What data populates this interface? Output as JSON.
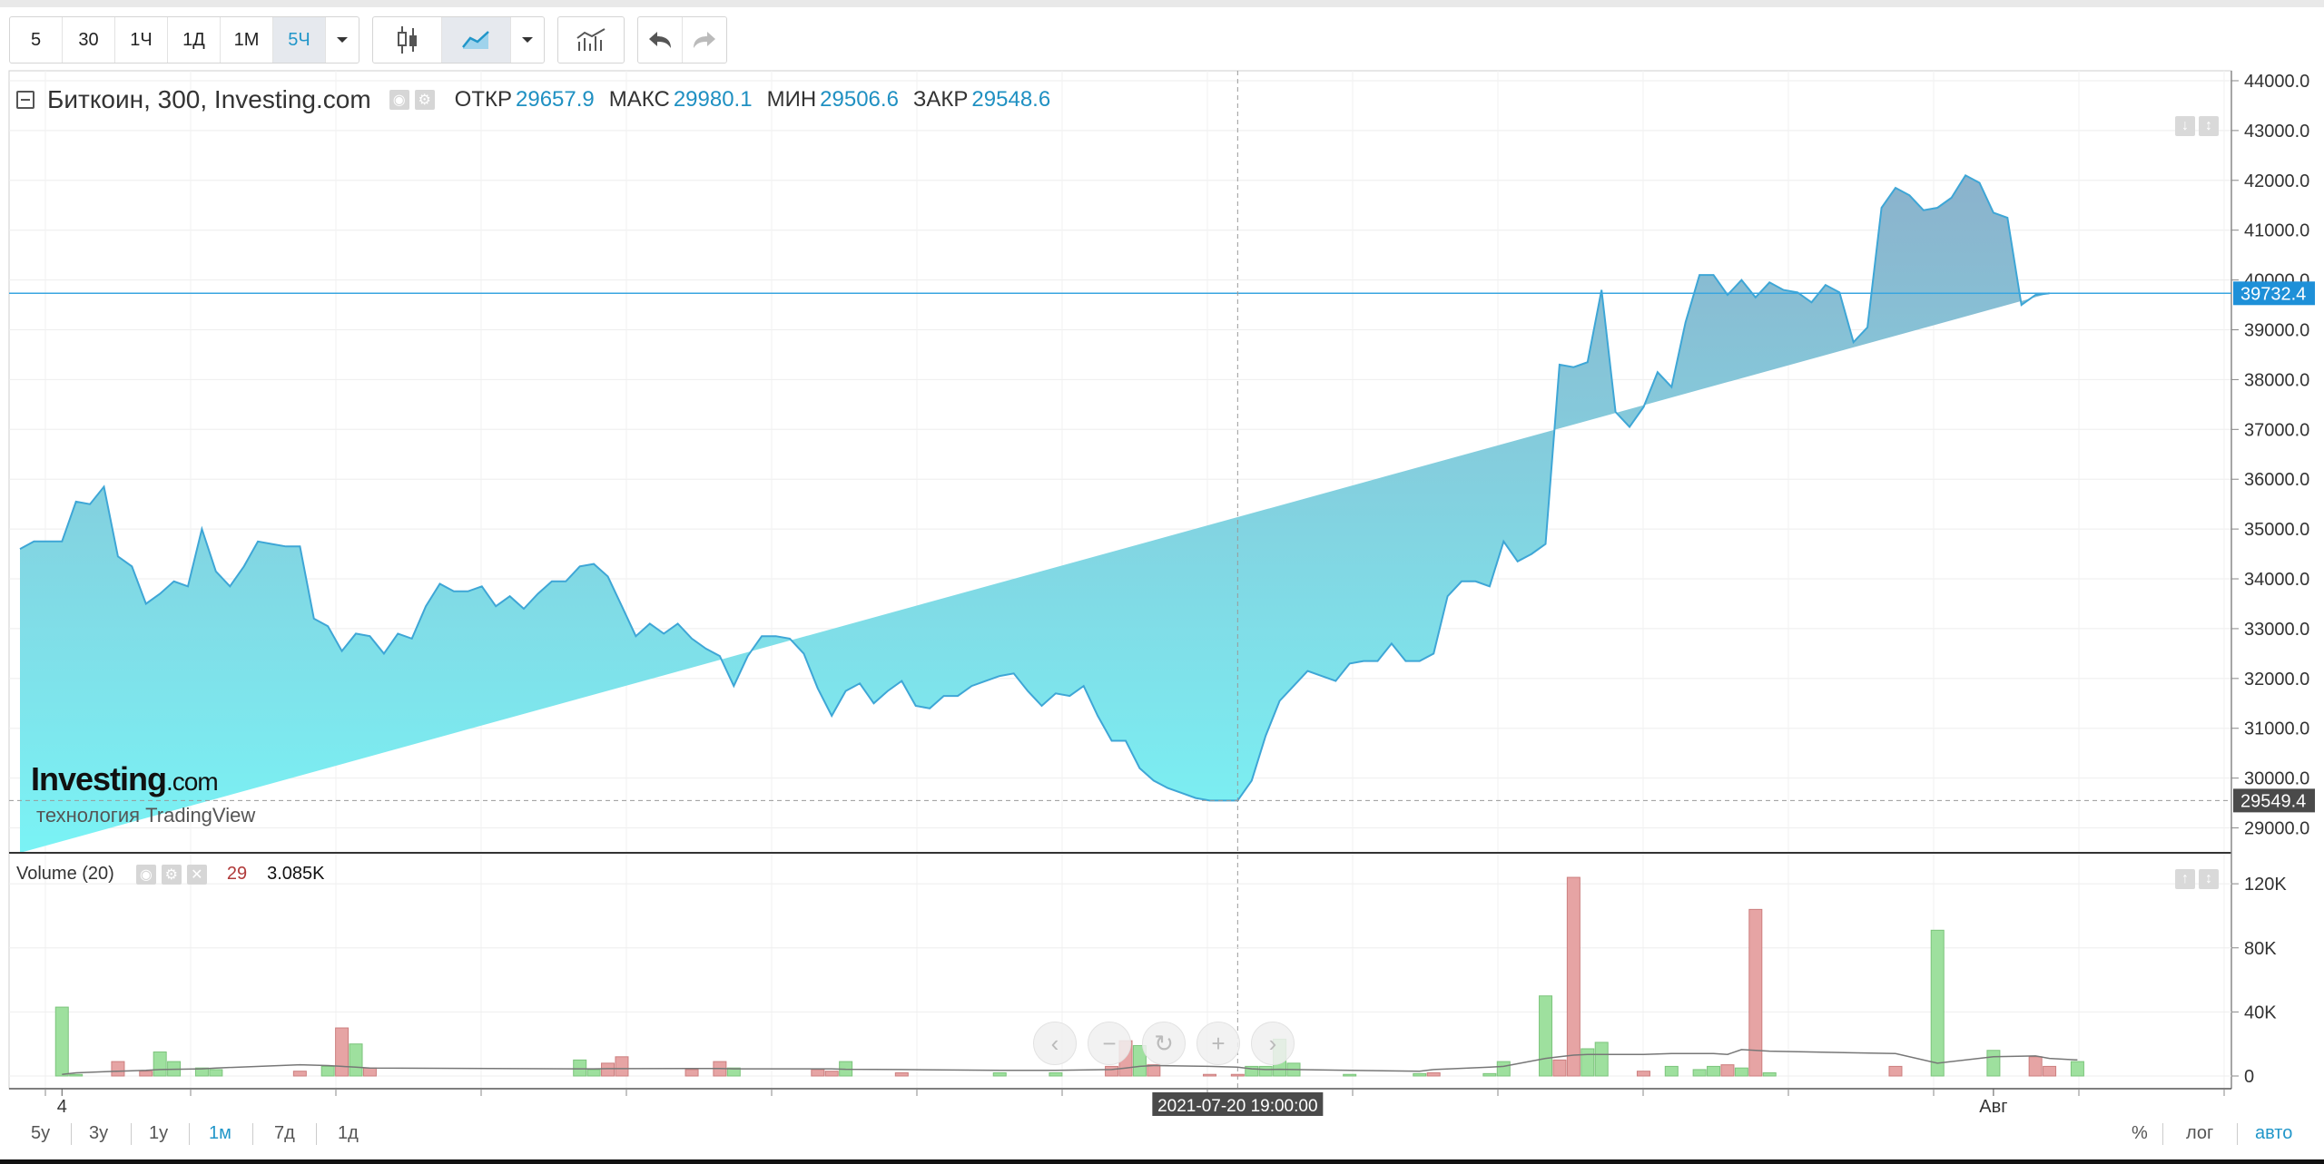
{
  "toolbar": {
    "intervals": [
      "5",
      "30",
      "1Ч",
      "1Д",
      "1М",
      "5Ч"
    ],
    "active_interval": "5Ч"
  },
  "legend": {
    "title": "Биткоин, 300, Investing.com",
    "open_label": "ОТКР",
    "open_value": "29657.9",
    "high_label": "МАКС",
    "high_value": "29980.1",
    "low_label": "МИН",
    "low_value": "29506.6",
    "close_label": "ЗАКР",
    "close_value": "29548.6"
  },
  "volume_legend": {
    "name": "Volume (20)",
    "length": "29",
    "value": "3.085K"
  },
  "watermark": {
    "brand": "Investing",
    "brand_suffix": ".com",
    "tagline": "технология TradingView"
  },
  "crosshair": {
    "time_label": "2021-07-20 19:00:00",
    "price_label": "29549.4"
  },
  "last_price_label": "39732.4",
  "bottom_bar": {
    "ranges": [
      "5y",
      "3y",
      "1y",
      "1м",
      "7д",
      "1д"
    ],
    "active_range": "1м",
    "right_options": [
      "%",
      "лог",
      "авто"
    ],
    "active_option": "авто"
  },
  "colors": {
    "line": "#3ea6d6",
    "fill_top": "#8bb2cc",
    "fill_bottom": "#7af3f5",
    "vol_up": "#9ee09e",
    "vol_down": "#e6a4a4",
    "accent": "#2196c9"
  },
  "chart_data": [
    {
      "type": "area",
      "title": "Биткоин, 300, Investing.com",
      "yticks": [
        "29000.0",
        "30000.0",
        "31000.0",
        "32000.0",
        "33000.0",
        "34000.0",
        "35000.0",
        "36000.0",
        "37000.0",
        "38000.0",
        "39000.0",
        "40000.0",
        "41000.0",
        "42000.0",
        "43000.0",
        "44000.0"
      ],
      "ylim": [
        28500,
        44200
      ],
      "xlim": [
        0,
        158
      ],
      "xticks": [
        {
          "x": 3,
          "label": "4"
        },
        {
          "x": 141,
          "label": "Авг"
        }
      ],
      "crosshair_x": 87,
      "crosshair_y": 29549.4,
      "last_price": 39732.4,
      "x": [
        0,
        1,
        2,
        3,
        4,
        5,
        6,
        7,
        8,
        9,
        10,
        11,
        12,
        13,
        14,
        15,
        16,
        17,
        18,
        19,
        20,
        21,
        22,
        23,
        24,
        25,
        26,
        27,
        28,
        29,
        30,
        31,
        32,
        33,
        34,
        35,
        36,
        37,
        38,
        39,
        40,
        41,
        42,
        43,
        44,
        45,
        46,
        47,
        48,
        49,
        50,
        51,
        52,
        53,
        54,
        55,
        56,
        57,
        58,
        59,
        60,
        61,
        62,
        63,
        64,
        65,
        66,
        67,
        68,
        69,
        70,
        71,
        72,
        73,
        74,
        75,
        76,
        77,
        78,
        79,
        80,
        81,
        82,
        83,
        84,
        85,
        86,
        87,
        88,
        89,
        90,
        91,
        92,
        93,
        94,
        95,
        96,
        97,
        98,
        99,
        100,
        101,
        102,
        103,
        104,
        105,
        106,
        107,
        108,
        109,
        110,
        111,
        112,
        113,
        114,
        115,
        116,
        117,
        118,
        119,
        120,
        121,
        122,
        123,
        124,
        125,
        126,
        127,
        128,
        129,
        130,
        131,
        132,
        133,
        134,
        135,
        136,
        137,
        138,
        139,
        140,
        141,
        142,
        143,
        144,
        145,
        146,
        147
      ],
      "values": [
        34600,
        34750,
        34750,
        34750,
        35550,
        35500,
        35850,
        34450,
        34250,
        33500,
        33700,
        33950,
        33850,
        35000,
        34150,
        33850,
        34250,
        34750,
        34700,
        34650,
        34650,
        33200,
        33050,
        32550,
        32900,
        32850,
        32500,
        32900,
        32800,
        33450,
        33900,
        33750,
        33750,
        33850,
        33450,
        33650,
        33400,
        33700,
        33950,
        33950,
        34250,
        34300,
        34050,
        33450,
        32850,
        33100,
        32900,
        33100,
        32800,
        32600,
        32450,
        31850,
        32450,
        32850,
        32850,
        32800,
        32500,
        31800,
        31250,
        31750,
        31900,
        31500,
        31750,
        31950,
        31450,
        31400,
        31650,
        31650,
        31850,
        31950,
        32050,
        32100,
        31750,
        31450,
        31700,
        31650,
        31850,
        31250,
        30750,
        30750,
        30200,
        29950,
        29800,
        29700,
        29600,
        29550,
        29550,
        29549,
        29950,
        30850,
        31550,
        31850,
        32150,
        32050,
        31950,
        32300,
        32350,
        32350,
        32700,
        32350,
        32350,
        32500,
        33650,
        33950,
        33950,
        33850,
        34750,
        34350,
        34500,
        34700,
        38300,
        38250,
        38350,
        39800,
        37350,
        37050,
        37450,
        38150,
        37850,
        39150,
        40100,
        40100,
        39700,
        40000,
        39650,
        39950,
        39800,
        39750,
        39550,
        39900,
        39750,
        38750,
        39050,
        41450,
        41850,
        41700,
        41400,
        41450,
        41650,
        42100,
        41950,
        41350,
        41250,
        39500,
        39700,
        39732
      ],
      "volume": {
        "ylim": [
          0,
          128000
        ],
        "yticks": [
          "0",
          "40K",
          "80K",
          "120K"
        ],
        "x": [
          3,
          4,
          7,
          9,
          10,
          11,
          13,
          14,
          20,
          22,
          23,
          24,
          25,
          40,
          41,
          42,
          43,
          48,
          50,
          51,
          57,
          58,
          59,
          63,
          70,
          74,
          78,
          79,
          80,
          81,
          85,
          87,
          88,
          89,
          90,
          91,
          95,
          100,
          101,
          105,
          106,
          109,
          110,
          111,
          112,
          113,
          116,
          118,
          120,
          121,
          122,
          123,
          124,
          125,
          134,
          137,
          141,
          144,
          145,
          147
        ],
        "values": [
          43000,
          1000,
          9000,
          3000,
          15000,
          9000,
          5000,
          4000,
          3000,
          6000,
          30000,
          20000,
          5000,
          10000,
          4000,
          8000,
          12000,
          4000,
          9000,
          5000,
          4000,
          3000,
          9000,
          2000,
          2000,
          2000,
          6000,
          22000,
          19000,
          7000,
          1000,
          1000,
          6000,
          6000,
          23000,
          8000,
          1000,
          1500,
          2000,
          1500,
          9000,
          50000,
          10000,
          124000,
          17000,
          21000,
          3000,
          6000,
          4000,
          6000,
          7000,
          5000,
          104000,
          2000,
          6000,
          91000,
          16000,
          12000,
          6000,
          9000
        ],
        "up": [
          true,
          true,
          false,
          false,
          true,
          true,
          true,
          true,
          false,
          true,
          false,
          true,
          false,
          true,
          true,
          false,
          false,
          false,
          false,
          true,
          false,
          false,
          true,
          false,
          true,
          true,
          false,
          false,
          true,
          false,
          false,
          false,
          true,
          true,
          true,
          true,
          true,
          true,
          false,
          true,
          true,
          true,
          false,
          false,
          true,
          true,
          false,
          true,
          true,
          true,
          false,
          true,
          false,
          true,
          false,
          true,
          true,
          false,
          false,
          true
        ],
        "ma": [
          1000,
          2000,
          3000,
          3500,
          4000,
          4200,
          4500,
          5000,
          7000,
          6500,
          6000,
          5500,
          5000,
          4500,
          4500,
          4600,
          4600,
          4700,
          4700,
          4500,
          4500,
          4500,
          4200,
          4000,
          3500,
          3500,
          4000,
          5000,
          6000,
          6500,
          6000,
          5500,
          4500,
          4000,
          4200,
          4000,
          3500,
          3000,
          4000,
          5500,
          6000,
          11000,
          12000,
          13000,
          13500,
          13500,
          13500,
          14000,
          14000,
          14000,
          13500,
          16500,
          16000,
          15500,
          14000,
          8000,
          12000,
          12500,
          11000,
          10000
        ]
      }
    }
  ]
}
